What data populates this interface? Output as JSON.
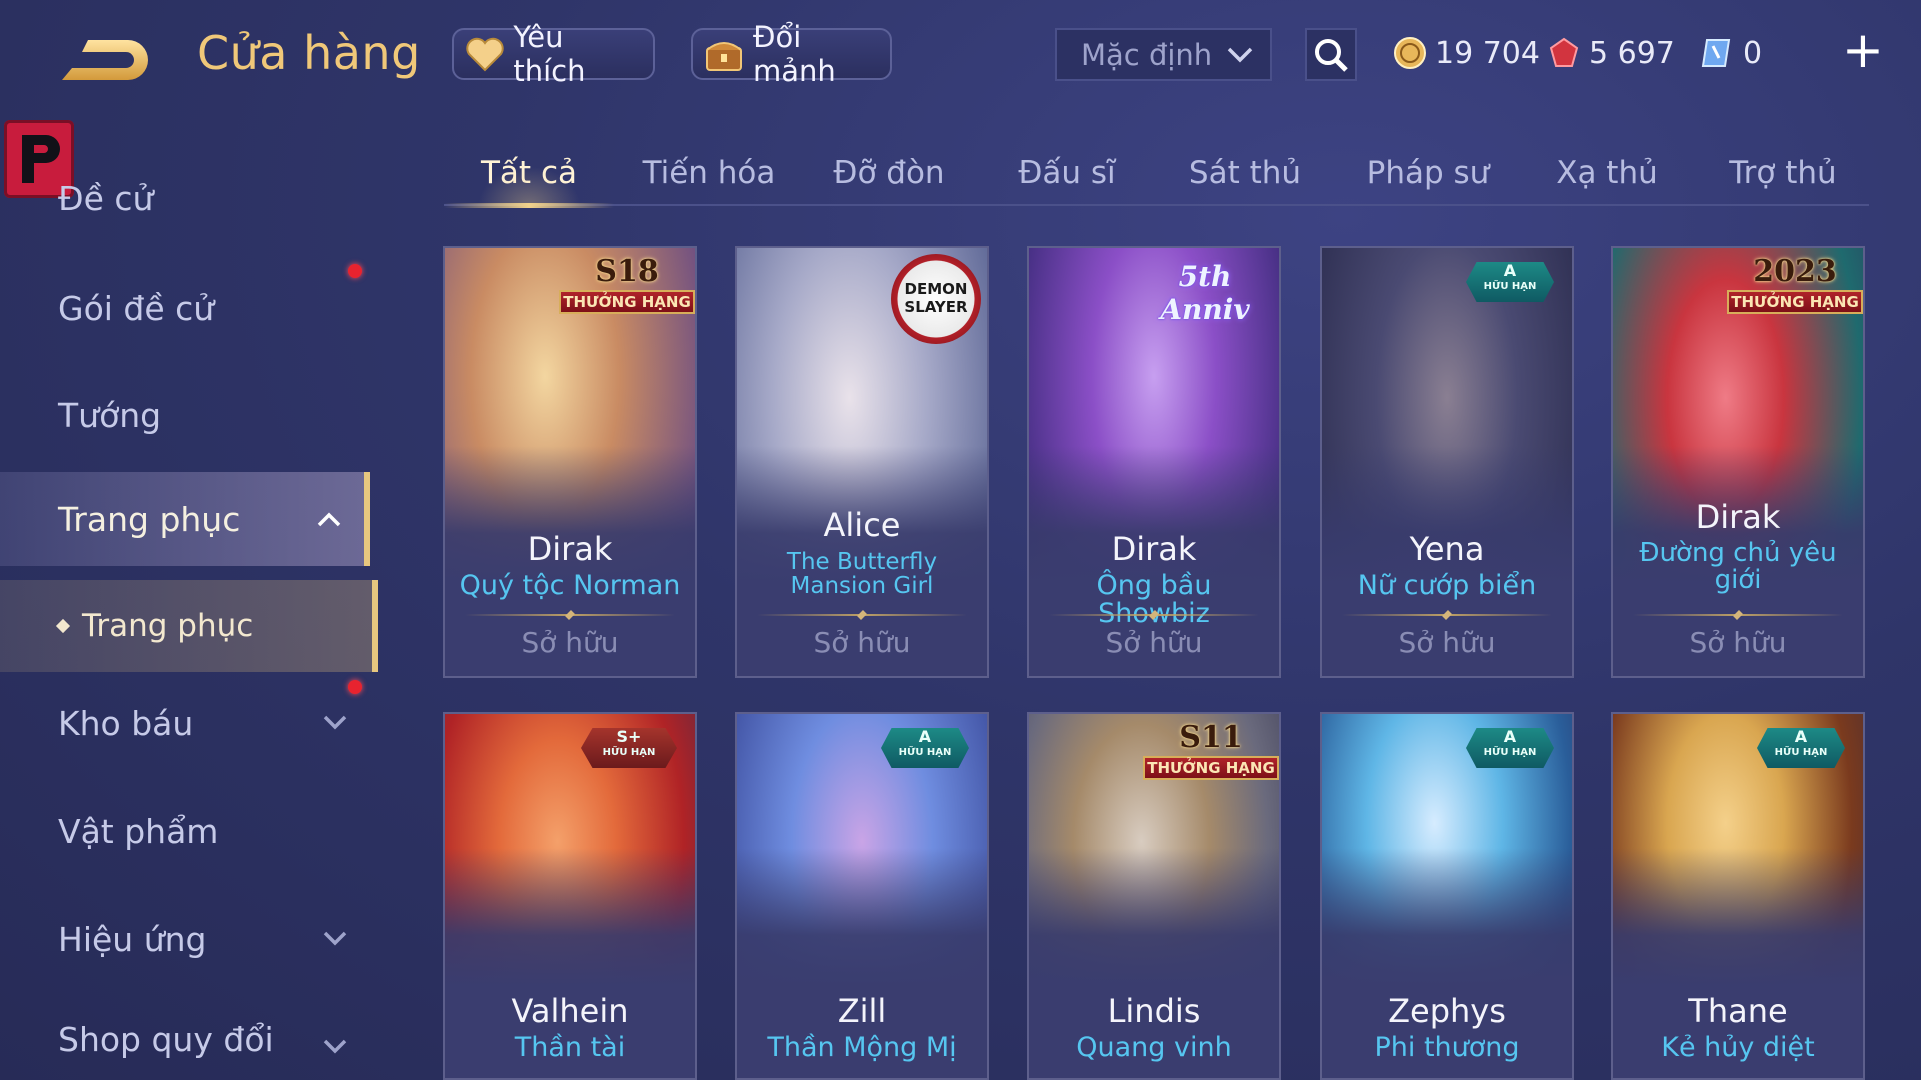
{
  "header": {
    "title": "Cửa hàng",
    "favorites_label": "Yêu thích",
    "exchange_shards_label": "Đổi mảnh",
    "sort": {
      "selected": "Mặc định"
    },
    "currencies": [
      {
        "name": "gold-coin-icon",
        "value": "19 704"
      },
      {
        "name": "ruby-icon",
        "value": "5 697"
      },
      {
        "name": "voucher-icon",
        "value": "0"
      }
    ],
    "add_currency": "+"
  },
  "sidebar": {
    "items": [
      {
        "label": "Đề cử",
        "has_dot": false,
        "expandable": false
      },
      {
        "label": "Gói đề cử",
        "has_dot": true,
        "expandable": false
      },
      {
        "label": "Tướng",
        "has_dot": false,
        "expandable": false
      },
      {
        "label": "Trang phục",
        "has_dot": false,
        "expandable": true,
        "expanded": true,
        "active": true
      },
      {
        "label": "Kho báu",
        "has_dot": true,
        "expandable": true
      },
      {
        "label": "Vật phẩm",
        "has_dot": false,
        "expandable": false
      },
      {
        "label": "Hiệu ứng",
        "has_dot": false,
        "expandable": true
      },
      {
        "label": "Shop quy đổi",
        "has_dot": false,
        "expandable": true
      }
    ],
    "sub_item": {
      "label": "Trang phục"
    }
  },
  "tabs": [
    {
      "label": "Tất cả",
      "active": true
    },
    {
      "label": "Tiến hóa"
    },
    {
      "label": "Đỡ đòn"
    },
    {
      "label": "Đấu sĩ"
    },
    {
      "label": "Sát thủ"
    },
    {
      "label": "Pháp sư"
    },
    {
      "label": "Xạ thủ"
    },
    {
      "label": "Trợ thủ"
    }
  ],
  "cards": [
    {
      "hero": "Dirak",
      "skin": "Quý tộc Norman",
      "status": "Sở hữu",
      "badge": "S18",
      "badge_text": "THƯỞNG HẠNG",
      "palette": [
        "#e8c58a",
        "#b9725a",
        "#6b4f86"
      ]
    },
    {
      "hero": "Alice",
      "skin": "The Butterfly Mansion Girl",
      "status": "Sở hữu",
      "badge": "DEMON SLAYER",
      "palette": [
        "#d8d0d8",
        "#9aa2c2",
        "#5a6490"
      ]
    },
    {
      "hero": "Dirak",
      "skin": "Ông bầu Showbiz",
      "status": "Sở hữu",
      "badge": "5th Anniv",
      "palette": [
        "#8b4fc7",
        "#5a2f9a",
        "#3a2a78"
      ]
    },
    {
      "hero": "Yena",
      "skin": "Nữ cướp biển",
      "status": "Sở hữu",
      "badge": "A",
      "badge_text": "HỮU HẠN",
      "palette": [
        "#4a4a72",
        "#2e2f52",
        "#3a3d66"
      ]
    },
    {
      "hero": "Dirak",
      "skin": "Đường chủ yêu giới",
      "status": "Sở hữu",
      "badge": "2023",
      "badge_text": "THƯỞNG HẠNG",
      "palette": [
        "#d2414f",
        "#1f6a6e",
        "#2b3c5f"
      ]
    },
    {
      "hero": "Valhein",
      "skin": "Thần tài",
      "badge": "S+",
      "badge_text": "HỮU HẠN",
      "palette": [
        "#e36a3b",
        "#b02326",
        "#4e2a48"
      ]
    },
    {
      "hero": "Zill",
      "skin": "Thần Mộng Mị",
      "badge": "A",
      "badge_text": "HỮU HẠN",
      "palette": [
        "#6f8de0",
        "#c9a4e6",
        "#3a4a9a"
      ]
    },
    {
      "hero": "Lindis",
      "skin": "Quang vinh",
      "badge": "S11",
      "badge_text": "THƯỞNG HẠNG",
      "palette": [
        "#6a6a7d",
        "#a58a6a",
        "#3b3b55"
      ]
    },
    {
      "hero": "Zephys",
      "skin": "Phi thương",
      "badge": "A",
      "badge_text": "HỮU HẠN",
      "palette": [
        "#5fb6e6",
        "#2a5e9a",
        "#2b2f63"
      ]
    },
    {
      "hero": "Thane",
      "skin": "Kẻ hủy diệt",
      "badge": "A",
      "badge_text": "HỮU HẠN",
      "palette": [
        "#d9a650",
        "#7a3a1e",
        "#3b2a3a"
      ]
    }
  ],
  "colors": {
    "accent_gold": "#f0c879",
    "skin_name_blue": "#56c6f0",
    "notification_red": "#e8232f"
  }
}
